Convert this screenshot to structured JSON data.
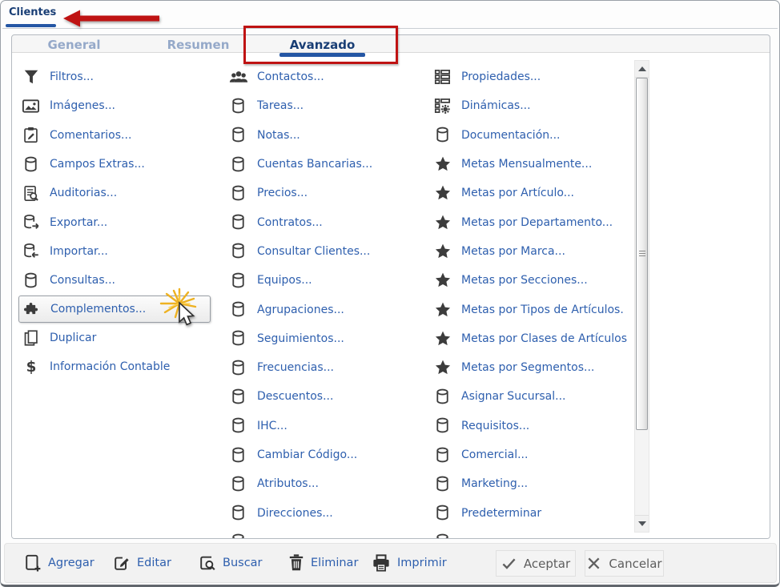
{
  "window": {
    "tab_label": "Clientes"
  },
  "tabs": [
    {
      "label": "General",
      "active": false
    },
    {
      "label": "Resumen",
      "active": false
    },
    {
      "label": "Avanzado",
      "active": true
    }
  ],
  "menu": {
    "columns": [
      {
        "items": [
          {
            "label": "Filtros...",
            "icon": "filter-icon"
          },
          {
            "label": "Imágenes...",
            "icon": "image-icon"
          },
          {
            "label": "Comentarios...",
            "icon": "clipboard-edit-icon"
          },
          {
            "label": "Campos Extras...",
            "icon": "database-icon"
          },
          {
            "label": "Auditorias...",
            "icon": "audit-search-icon"
          },
          {
            "label": "Exportar...",
            "icon": "export-icon"
          },
          {
            "label": "Importar...",
            "icon": "import-icon"
          },
          {
            "label": "Consultas...",
            "icon": "database-icon"
          },
          {
            "label": "Complementos...",
            "icon": "puzzle-icon",
            "highlighted": true
          },
          {
            "label": "Duplicar",
            "icon": "copy-icon"
          },
          {
            "label": "Información Contable",
            "icon": "dollar-icon"
          }
        ]
      },
      {
        "items": [
          {
            "label": "Contactos...",
            "icon": "contacts-icon"
          },
          {
            "label": "Tareas...",
            "icon": "database-icon"
          },
          {
            "label": "Notas...",
            "icon": "database-icon"
          },
          {
            "label": "Cuentas Bancarias...",
            "icon": "database-icon"
          },
          {
            "label": "Precios...",
            "icon": "database-icon"
          },
          {
            "label": "Contratos...",
            "icon": "database-icon"
          },
          {
            "label": "Consultar Clientes...",
            "icon": "database-icon"
          },
          {
            "label": "Equipos...",
            "icon": "database-icon"
          },
          {
            "label": "Agrupaciones...",
            "icon": "database-icon"
          },
          {
            "label": "Seguimientos...",
            "icon": "database-icon"
          },
          {
            "label": "Frecuencias...",
            "icon": "database-icon"
          },
          {
            "label": "Descuentos...",
            "icon": "database-icon"
          },
          {
            "label": "IHC...",
            "icon": "database-icon"
          },
          {
            "label": "Cambiar Código...",
            "icon": "database-icon"
          },
          {
            "label": "Atributos...",
            "icon": "database-icon"
          },
          {
            "label": "Direcciones...",
            "icon": "database-icon"
          },
          {
            "label": "",
            "icon": "database-icon",
            "partial": true
          }
        ]
      },
      {
        "items": [
          {
            "label": "Propiedades...",
            "icon": "properties-grid-icon"
          },
          {
            "label": "Dinámicas...",
            "icon": "dynamics-gear-icon"
          },
          {
            "label": "Documentación...",
            "icon": "database-icon"
          },
          {
            "label": "Metas Mensualmente...",
            "icon": "star-icon"
          },
          {
            "label": "Metas por Artículo...",
            "icon": "star-icon"
          },
          {
            "label": "Metas por Departamento...",
            "icon": "star-icon"
          },
          {
            "label": "Metas por Marca...",
            "icon": "star-icon"
          },
          {
            "label": "Metas por Secciones...",
            "icon": "star-icon"
          },
          {
            "label": "Metas por Tipos de Artículos.",
            "icon": "star-icon"
          },
          {
            "label": "Metas por Clases de Artículos",
            "icon": "star-icon"
          },
          {
            "label": "Metas por Segmentos...",
            "icon": "star-icon"
          },
          {
            "label": "Asignar Sucursal...",
            "icon": "database-icon"
          },
          {
            "label": "Requisitos...",
            "icon": "database-icon"
          },
          {
            "label": "Comercial...",
            "icon": "database-icon"
          },
          {
            "label": "Marketing...",
            "icon": "database-icon"
          },
          {
            "label": "Predeterminar",
            "icon": "database-icon"
          },
          {
            "label": "",
            "icon": "database-icon",
            "partial": true
          }
        ]
      }
    ]
  },
  "footer": {
    "actions": [
      {
        "label": "Agregar",
        "icon": "add-icon"
      },
      {
        "label": "Editar",
        "icon": "edit-icon"
      },
      {
        "label": "Buscar",
        "icon": "search-icon"
      },
      {
        "label": "Eliminar",
        "icon": "trash-icon"
      },
      {
        "label": "Imprimir",
        "icon": "print-icon"
      }
    ],
    "buttons": [
      {
        "label": "Aceptar",
        "icon": "check-icon"
      },
      {
        "label": "Cancelar",
        "icon": "close-icon"
      }
    ]
  },
  "colors": {
    "link_blue": "#2e5fae",
    "navy_title": "#193e75",
    "inactive_tab": "#95a9c9",
    "tab_underline": "#2456a4",
    "annotation_red": "#bf1313",
    "icon_dark": "#3c3c3c",
    "highlight_border": "#989ea5"
  }
}
